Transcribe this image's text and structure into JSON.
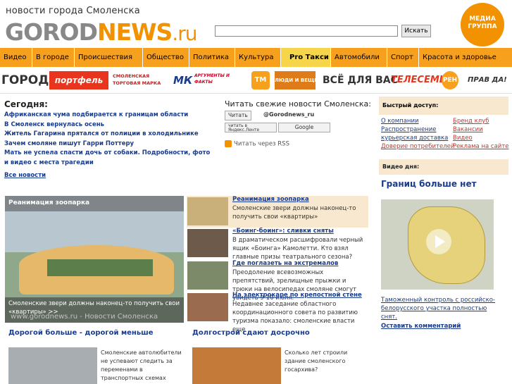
{
  "header": {
    "tagline": "новости города Смоленска",
    "logo_part1": "GOROD",
    "logo_part2": "NEWS",
    "logo_part3": ".ru",
    "search_placeholder": "",
    "search_button": "Искать",
    "media_logo_line1": "МЕДИА",
    "media_logo_line2": "ГРУППА"
  },
  "nav": {
    "items": [
      {
        "label": "Видео"
      },
      {
        "label": "В городе"
      },
      {
        "label": "Происшествия"
      },
      {
        "label": "Общество"
      },
      {
        "label": "Политика"
      },
      {
        "label": "Культура"
      },
      {
        "label": "Pro Такси"
      },
      {
        "label": "Автомобили"
      },
      {
        "label": "Спорт"
      },
      {
        "label": "Красота и здоровье"
      }
    ]
  },
  "partners": {
    "p1": "ГОРОД",
    "p2": "портфель",
    "p3": "СМОЛЕНСКАЯ ТОРГОВАЯ МАРКА",
    "p4": "МК",
    "p5": "АРГУМЕНТЫ И ФАКТЫ",
    "p6": "ТМ",
    "p7": "ЛЮДИ И ВЕЩИ",
    "p8": "ВСЁ ДЛЯ ВАС",
    "p9": "ТЕЛЕСЕМЬ",
    "p10": "РЕН",
    "p11": "ПРАВ ДА!"
  },
  "today": {
    "title": "Сегодня:",
    "items": [
      "Африканская чума подбирается к границам области",
      "В Смоленск вернулась осень",
      "Житель Гагарина прятался от полиции в холодильнике",
      "Зачем смоляне пишут Гарри Поттеру",
      "Мать не успела спасти дочь от собаки. Подробности, фото и видео с места трагедии"
    ],
    "all_news": "Все новости"
  },
  "subscribe": {
    "title": "Читать свежие новости Смоленска:",
    "twitter_btn": "Читать",
    "twitter_handle": "@Gorodnews_ru",
    "yandex_btn": "читать в Яндекс.Ленте",
    "google_btn": "Google",
    "rss": "Читать через RSS"
  },
  "quick": {
    "title": "Быстрый доступ:",
    "left": [
      "О компании",
      "Распространение курьерская доставка",
      "Доверие потребителей"
    ],
    "right": [
      "Бренд клуб",
      "Вакансии",
      "Видео",
      "Реклама на сайте"
    ]
  },
  "video": {
    "head": "Видео дня:",
    "title": "Границ больше нет",
    "caption": "Таможенный контроль с российско-белорусского участка полностью снят.",
    "comment": "Оставить комментарий"
  },
  "feature": {
    "label": "Реанимация зоопарка",
    "caption": "Смоленские звери должны наконец-то получить свои «квартиры» >>",
    "watermark": "www.gorodnews.ru - Новости Смоленска"
  },
  "teasers": [
    {
      "title": "Реанимация зоопарка",
      "text": "Смоленские звери должны наконец-то получить свои «квартиры»"
    },
    {
      "title": "«Боинг-боинг»: сливки сняты",
      "text": "В драматическом расшифровали черный ящик «Боинга» Камолетти. Кто взял главные призы театрального сезона?"
    },
    {
      "title": "Где поглазеть на экстремалов",
      "text": "Преодоление всевозможных препятствий, зрелищные прыжки и трюки на велосипедах смоляне смогут увидеть 9-10 июля."
    },
    {
      "title": "На электрокаре по крепостной стене",
      "text": "Недавнее заседание областного координационного совета по развитию туризма показало: смоленские власти еще"
    }
  ],
  "bottom": [
    {
      "title": "Дорогой больше - дорогой меньше",
      "text": "Смоленские автолюбители не успевают следить за переменами в транспортных схемах"
    },
    {
      "title": "Долгострой сдают досрочно",
      "text": "Сколько лет строили здание смоленского госархива?"
    }
  ]
}
